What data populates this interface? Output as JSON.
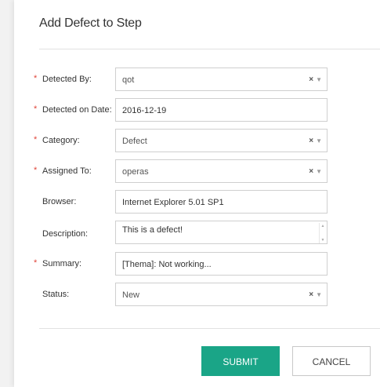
{
  "dialog": {
    "title": "Add Defect to Step",
    "close_glyph": "›"
  },
  "fields": [
    {
      "label": "Detected By:",
      "required": true,
      "value": "qot",
      "kind": "select"
    },
    {
      "label": "Detected on Date:",
      "required": true,
      "value": "2016-12-19",
      "kind": "text"
    },
    {
      "label": "Category:",
      "required": true,
      "value": "Defect",
      "kind": "select"
    },
    {
      "label": "Assigned To:",
      "required": true,
      "value": "operas",
      "kind": "select"
    },
    {
      "label": "Browser:",
      "required": false,
      "value": "Internet Explorer 5.01 SP1",
      "kind": "text"
    },
    {
      "label": "Description:",
      "required": false,
      "value": "This is a defect!",
      "kind": "textarea"
    },
    {
      "label": "Summary:",
      "required": true,
      "value": "[Thema]: Not working...",
      "kind": "text"
    },
    {
      "label": "Status:",
      "required": false,
      "value": "New",
      "kind": "select"
    }
  ],
  "glyphs": {
    "required": "*",
    "clear": "×",
    "dropdown": "▼",
    "scroll_up": "▲",
    "scroll_down": "▼"
  },
  "buttons": {
    "submit": "SUBMIT",
    "cancel": "CANCEL"
  },
  "colors": {
    "accent": "#1aa587",
    "required": "#e0453a"
  }
}
